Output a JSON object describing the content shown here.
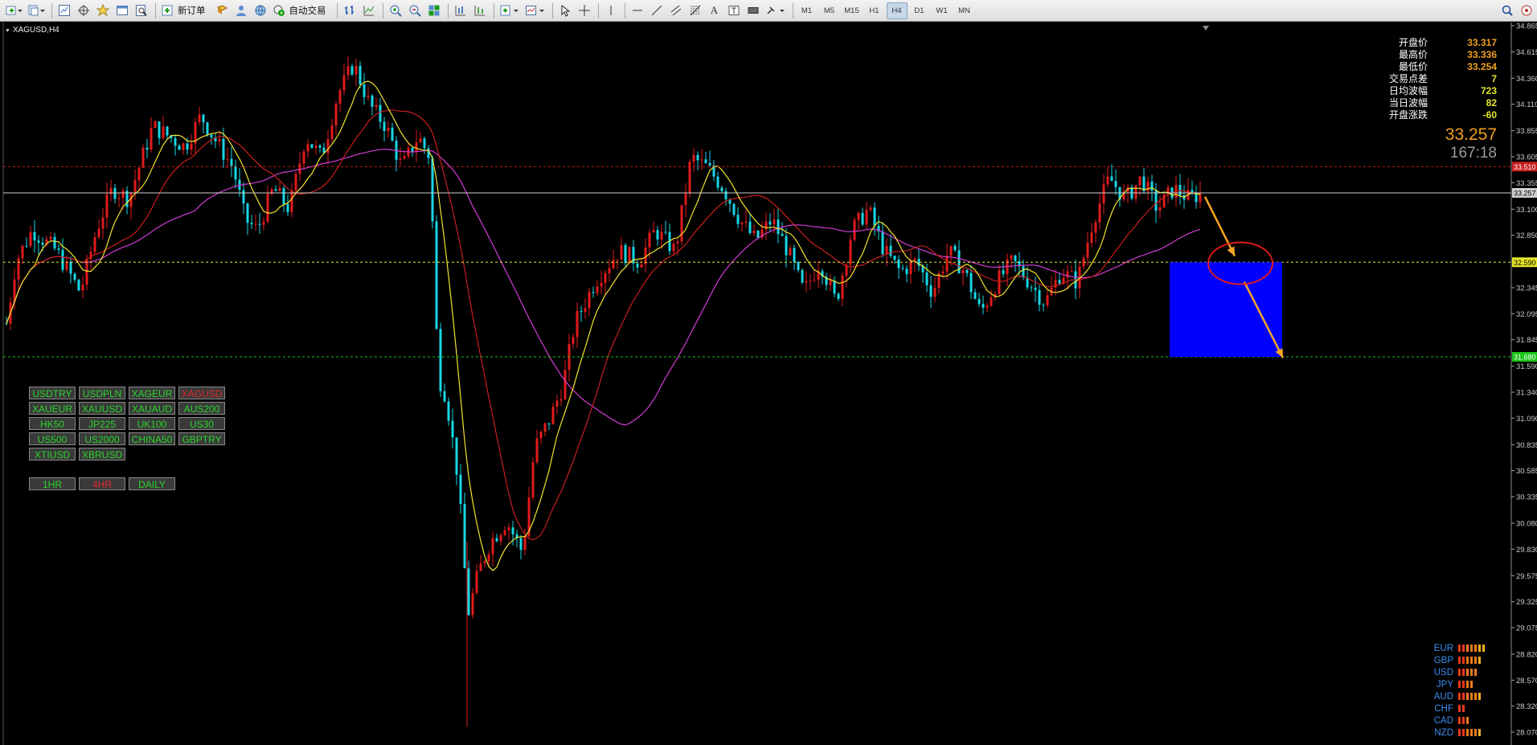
{
  "toolbar": {
    "new_order": "新订单",
    "auto_trading": "自动交易",
    "timeframes": [
      "M1",
      "M5",
      "M15",
      "H1",
      "H4",
      "D1",
      "W1",
      "MN"
    ],
    "active_timeframe": "H4"
  },
  "chart": {
    "title": "XAGUSD,H4",
    "colors": {
      "bull": "#e01b1b",
      "bear": "#19d6e6",
      "ma_fast": "#f2e52c",
      "ma_mid": "#c81e1e",
      "ma_slow": "#d43ad4",
      "zone": "#0000ff",
      "arrow": "#f5a623"
    }
  },
  "axis": {
    "ticks": [
      "34.865",
      "34.615",
      "34.360",
      "34.110",
      "33.855",
      "33.605",
      "33.355",
      "33.100",
      "32.850",
      "32.595",
      "32.345",
      "32.095",
      "31.845",
      "31.590",
      "31.340",
      "31.090",
      "30.835",
      "30.585",
      "30.335",
      "30.080",
      "29.830",
      "29.575",
      "29.325",
      "29.075",
      "28.820",
      "28.570",
      "28.320",
      "28.070"
    ],
    "markers": [
      {
        "value": "33.510",
        "color": "#c81e1e"
      },
      {
        "value": "33.257",
        "color": "#d0d0d0"
      },
      {
        "value": "32.590",
        "color": "#e6e62a"
      },
      {
        "value": "31.680",
        "color": "#19c519"
      }
    ]
  },
  "info": {
    "rows": [
      {
        "label": "开盘价",
        "value": "33.317",
        "color": "#f0a020"
      },
      {
        "label": "最高价",
        "value": "33.336",
        "color": "#f0a020"
      },
      {
        "label": "最低价",
        "value": "33.254",
        "color": "#f0a020"
      },
      {
        "label": "交易点差",
        "value": "7",
        "color": "#e6e62a"
      },
      {
        "label": "日均波幅",
        "value": "723",
        "color": "#e6e62a"
      },
      {
        "label": "当日波幅",
        "value": "82",
        "color": "#e6e62a"
      },
      {
        "label": "开盘涨跌",
        "value": "-60",
        "color": "#e6e62a"
      }
    ],
    "price": "33.257",
    "timer": "167:18"
  },
  "symbols": {
    "buttons": [
      {
        "label": "USDTRY",
        "active": false
      },
      {
        "label": "USDPLN",
        "active": false
      },
      {
        "label": "XAGEUR",
        "active": false
      },
      {
        "label": "XAGUSD",
        "active": true
      },
      {
        "label": "XAUEUR",
        "active": false
      },
      {
        "label": "XAUUSD",
        "active": false
      },
      {
        "label": "XAUAUD",
        "active": false
      },
      {
        "label": "AUS200",
        "active": false
      },
      {
        "label": "HK50",
        "active": false
      },
      {
        "label": "JP225",
        "active": false
      },
      {
        "label": "UK100",
        "active": false
      },
      {
        "label": "US30",
        "active": false
      },
      {
        "label": "US500",
        "active": false
      },
      {
        "label": "US2000",
        "active": false
      },
      {
        "label": "CHINA50",
        "active": false
      },
      {
        "label": "GBPTRY",
        "active": false
      },
      {
        "label": "XTIUSD",
        "active": false
      },
      {
        "label": "XBRUSD",
        "active": false
      }
    ],
    "timeframe_buttons": [
      {
        "label": "1HR",
        "active": false
      },
      {
        "label": "4HR",
        "active": true
      },
      {
        "label": "DAILY",
        "active": false
      }
    ]
  },
  "currency_strength": [
    {
      "name": "EUR",
      "level": 7
    },
    {
      "name": "GBP",
      "level": 6
    },
    {
      "name": "USD",
      "level": 5
    },
    {
      "name": "JPY",
      "level": 4
    },
    {
      "name": "AUD",
      "level": 6
    },
    {
      "name": "CHF",
      "level": 2
    },
    {
      "name": "CAD",
      "level": 3
    },
    {
      "name": "NZD",
      "level": 6
    }
  ]
}
